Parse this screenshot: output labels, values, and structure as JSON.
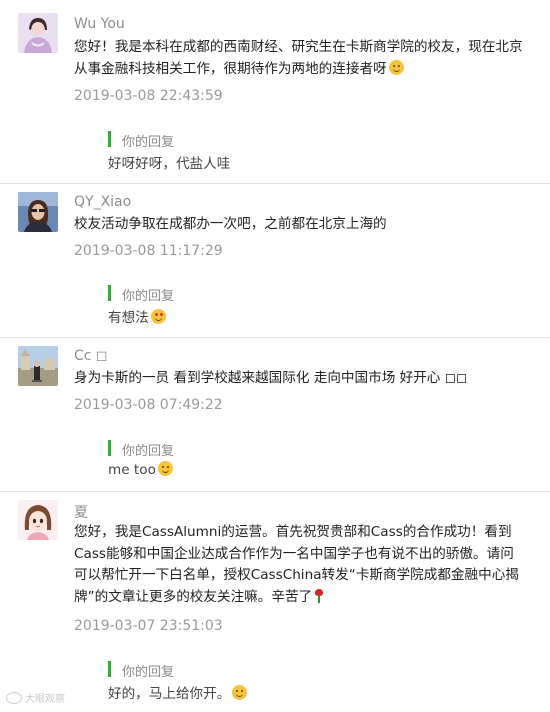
{
  "comments": [
    {
      "name": "Wu You",
      "text": "您好！我是本科在成都的西南财经、研究生在卡斯商学院的校友，现在北京从事金融科技相关工作，很期待作为两地的连接者呀",
      "time": "2019-03-08 22:43:59",
      "reply_label": "你的回复",
      "reply_text": "好呀好呀，代盐人哇"
    },
    {
      "name": "QY_Xiao",
      "text": "校友活动争取在成都办一次吧，之前都在北京上海的",
      "time": "2019-03-08 11:17:29",
      "reply_label": "你的回复",
      "reply_text": "有想法"
    },
    {
      "name": "Cc ◻",
      "text": "身为卡斯的一员 看到学校越来越国际化 走向中国市场 好开心 ◻◻",
      "time": "2019-03-08 07:49:22",
      "reply_label": "你的回复",
      "reply_text": "me too"
    },
    {
      "name": "夏",
      "text": "您好，我是CassAlumni的运营。首先祝贺贵部和Cass的合作成功！看到Cass能够和中国企业达成合作作为一名中国学子也有说不出的骄傲。请问可以帮忙开一下白名单，授权CassChina转发“卡斯商学院成都金融中心揭牌”的文章让更多的校友关注嘛。辛苦了",
      "time": "2019-03-07 23:51:03",
      "reply_label": "你的回复",
      "reply_text": "好的，马上给你开。"
    }
  ],
  "watermark": "大眼观察",
  "colors": {
    "reply_bar": "#28b12d",
    "name": "#8c8c8c",
    "time": "#9a9a9a",
    "divider": "#e6e6e6"
  },
  "icons": {
    "smile": "smile-emoji-icon",
    "heart_eyes": "heart-eyes-emoji-icon",
    "rose": "rose-icon",
    "thinking": "thinking-emoji-icon"
  }
}
